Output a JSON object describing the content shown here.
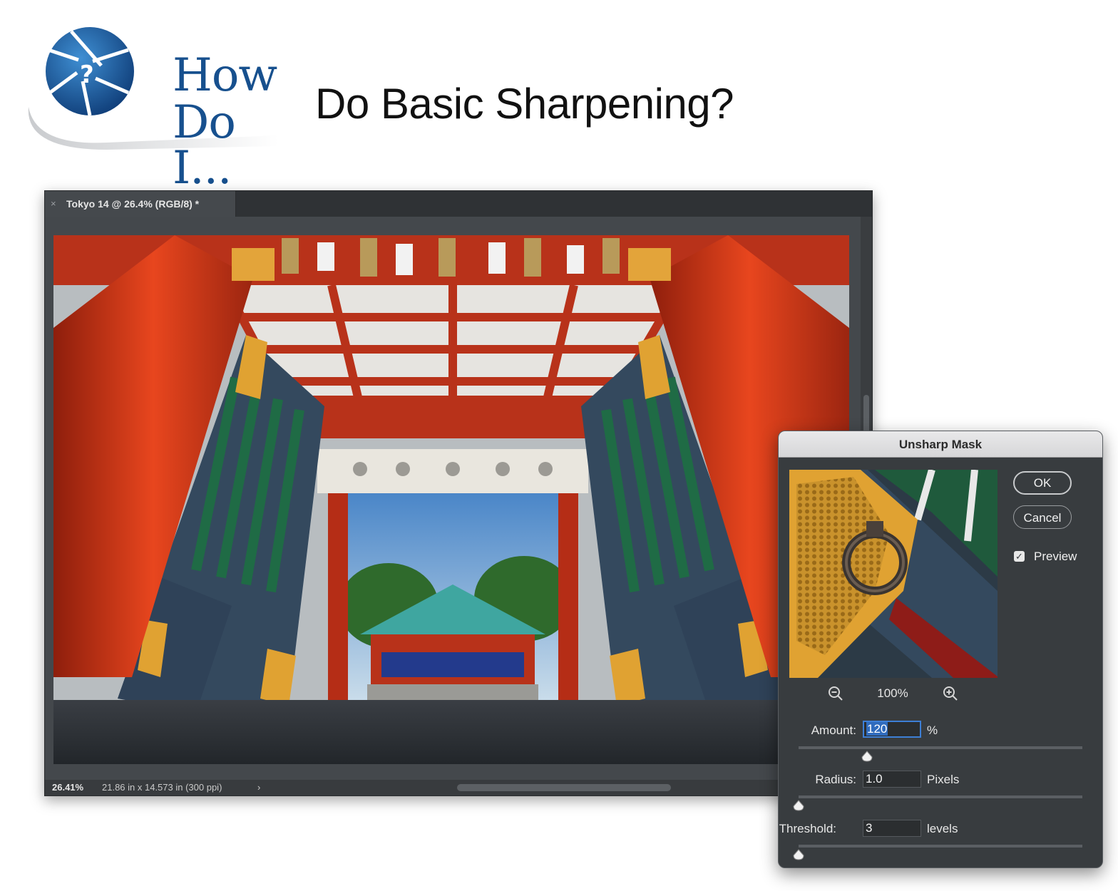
{
  "header": {
    "logo_line1": "How",
    "logo_line2": "Do I...",
    "headline": "Do Basic Sharpening?"
  },
  "document": {
    "tab_title": "Tokyo 14 @ 26.4% (RGB/8) *",
    "tab_close_icon": "close-icon",
    "status_zoom": "26.41%",
    "status_size": "21.86 in x 14.573 in (300 ppi)",
    "status_chevron": "›"
  },
  "dialog": {
    "title": "Unsharp Mask",
    "ok_label": "OK",
    "cancel_label": "Cancel",
    "preview_label": "Preview",
    "preview_checked": true,
    "zoom_percent": "100%",
    "zoom_out_icon": "zoom-out-icon",
    "zoom_in_icon": "zoom-in-icon",
    "amount": {
      "label": "Amount:",
      "value": "120",
      "unit": "%",
      "slider_fraction": 0.24
    },
    "radius": {
      "label": "Radius:",
      "value": "1.0",
      "unit": "Pixels",
      "slider_fraction": 0.0
    },
    "threshold": {
      "label": "Threshold:",
      "value": "3",
      "unit": "levels",
      "slider_fraction": 0.0
    }
  },
  "colors": {
    "brand_blue": "#17508e",
    "panel_bg": "#383c3f",
    "selection_blue": "#2f6bbd"
  }
}
